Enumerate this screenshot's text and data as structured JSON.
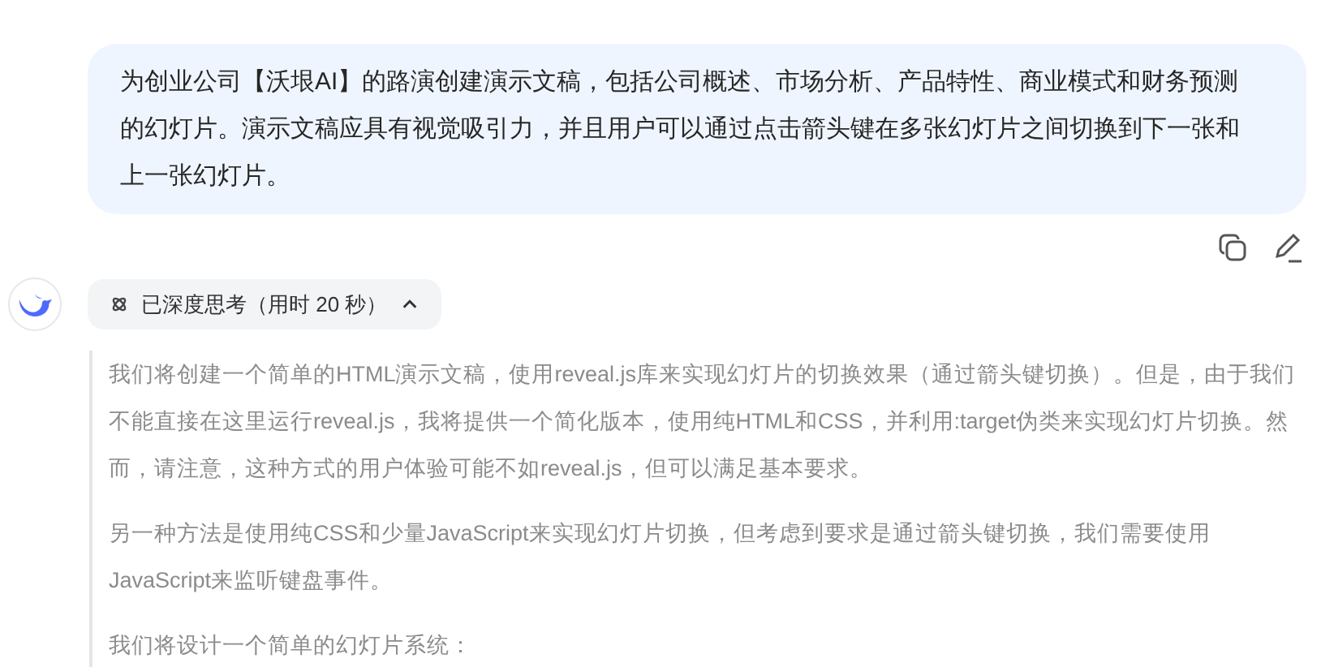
{
  "user_message": {
    "text": "为创业公司【沃垠AI】的路演创建演示文稿，包括公司概述、市场分析、产品特性、商业模式和财务预测的幻灯片。演示文稿应具有视觉吸引力，并且用户可以通过点击箭头键在多张幻灯片之间切换到下一张和上一张幻灯片。"
  },
  "thinking": {
    "label": "已深度思考（用时 20 秒）",
    "expanded": true,
    "paragraphs": [
      "我们将创建一个简单的HTML演示文稿，使用reveal.js库来实现幻灯片的切换效果（通过箭头键切换）。但是，由于我们不能直接在这里运行reveal.js，我将提供一个简化版本，使用纯HTML和CSS，并利用:target伪类来实现幻灯片切换。然而，请注意，这种方式的用户体验可能不如reveal.js，但可以满足基本要求。",
      "另一种方法是使用纯CSS和少量JavaScript来实现幻灯片切换，但考虑到要求是通过箭头键切换，我们需要使用JavaScript来监听键盘事件。",
      "我们将设计一个简单的幻灯片系统："
    ]
  }
}
